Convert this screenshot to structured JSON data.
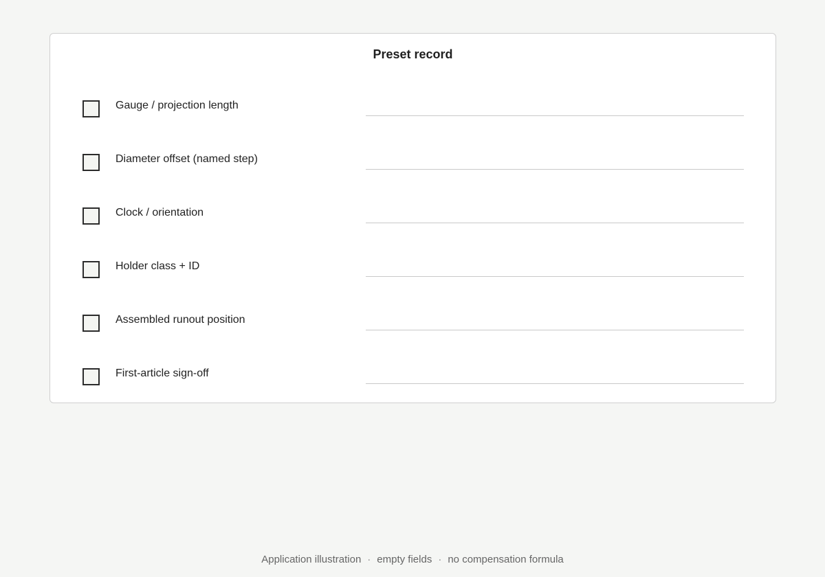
{
  "card": {
    "title": "Preset record",
    "rows": [
      {
        "label": "Gauge / projection length",
        "checked": false,
        "value": ""
      },
      {
        "label": "Diameter offset (named step)",
        "checked": false,
        "value": ""
      },
      {
        "label": "Clock / orientation",
        "checked": false,
        "value": ""
      },
      {
        "label": "Holder class + ID",
        "checked": false,
        "value": ""
      },
      {
        "label": "Assembled runout position",
        "checked": false,
        "value": ""
      },
      {
        "label": "First-article sign-off",
        "checked": false,
        "value": ""
      }
    ]
  },
  "footer": {
    "parts": [
      "Application illustration",
      "empty fields",
      "no compensation formula"
    ],
    "separator": "·"
  }
}
